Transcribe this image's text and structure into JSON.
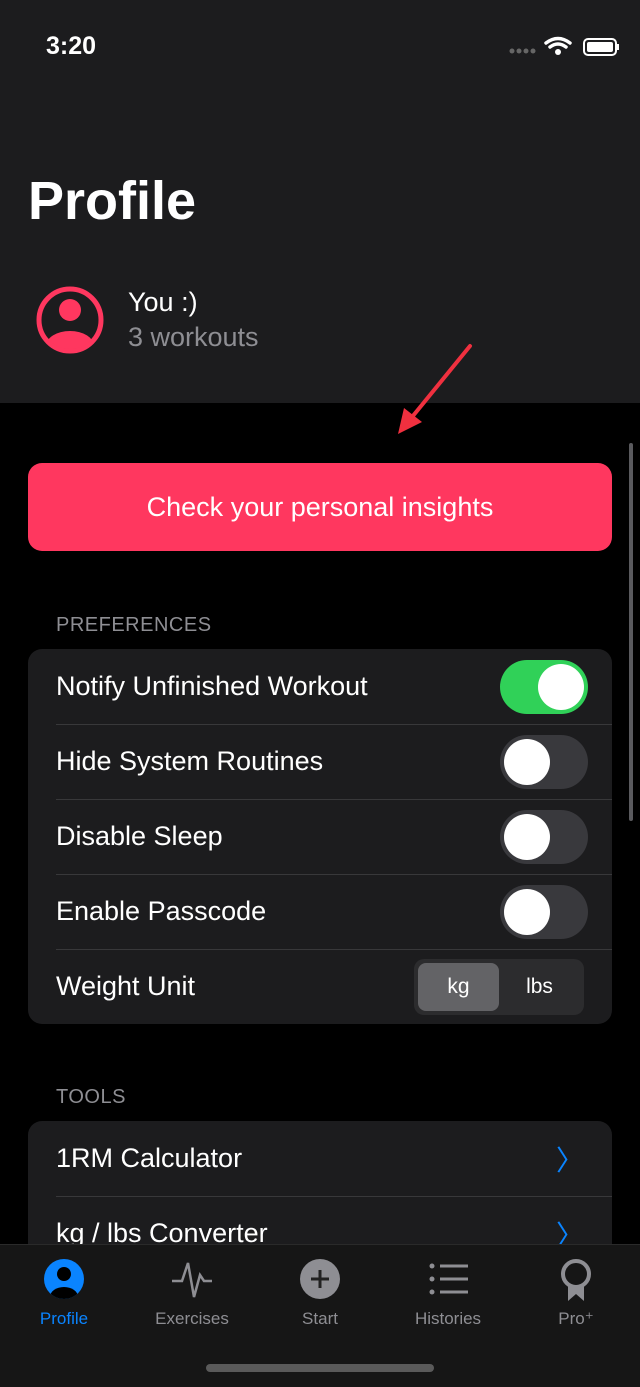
{
  "status": {
    "time": "3:20"
  },
  "header": {
    "title": "Profile",
    "user_name": "You :)",
    "workouts": "3 workouts"
  },
  "insights_button": "Check your personal insights",
  "preferences": {
    "label": "PREFERENCES",
    "items": [
      {
        "label": "Notify Unfinished Workout",
        "on": true
      },
      {
        "label": "Hide System Routines",
        "on": false
      },
      {
        "label": "Disable Sleep",
        "on": false
      },
      {
        "label": "Enable Passcode",
        "on": false
      }
    ],
    "weight_unit": {
      "label": "Weight Unit",
      "options": [
        "kg",
        "lbs"
      ],
      "selected": "kg"
    }
  },
  "tools": {
    "label": "TOOLS",
    "items": [
      "1RM Calculator",
      "kg / lbs Converter"
    ]
  },
  "tabs": [
    {
      "label": "Profile",
      "icon": "person-circle-icon",
      "active": true
    },
    {
      "label": "Exercises",
      "icon": "pulse-icon"
    },
    {
      "label": "Start",
      "icon": "plus-circle-icon"
    },
    {
      "label": "Histories",
      "icon": "list-icon"
    },
    {
      "label": "Pro⁺",
      "icon": "award-icon"
    }
  ],
  "colors": {
    "accent": "#ff375f",
    "tab_active": "#0a84ff",
    "toggle_on": "#30d158"
  }
}
